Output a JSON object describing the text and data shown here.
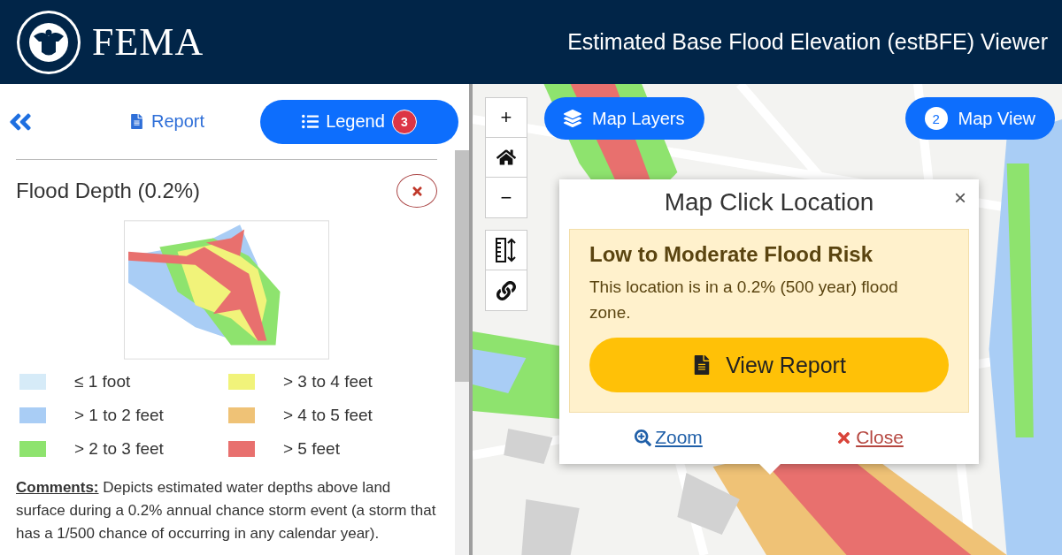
{
  "header": {
    "logo_text": "FEMA",
    "title": "Estimated Base Flood Elevation (estBFE) Viewer"
  },
  "sidebar": {
    "tabs": [
      {
        "label": "Report",
        "kind": "report",
        "selected": false
      },
      {
        "label": "Legend",
        "kind": "legend",
        "selected": true,
        "badge": "3"
      }
    ],
    "legend": {
      "title": "Flood Depth (0.2%)",
      "items": [
        {
          "label": "≤ 1 foot",
          "color": "#d6ebf8"
        },
        {
          "label": "> 3 to 4 feet",
          "color": "#f1f37a"
        },
        {
          "label": "> 1 to 2 feet",
          "color": "#a9cdf5"
        },
        {
          "label": "> 4 to 5 feet",
          "color": "#efc276"
        },
        {
          "label": "> 2 to 3 feet",
          "color": "#8ee36e"
        },
        {
          "label": "> 5 feet",
          "color": "#e8706e"
        }
      ],
      "comments": "**Comments:** Depicts estimated water depths above land surface during a 0.2% annual chance storm event (a storm that has a 1/500 chance of occurring in any calendar year)."
    }
  },
  "map": {
    "controls": [
      {
        "label": "+",
        "kind": "zoom-in"
      },
      {
        "kind": "home"
      },
      {
        "label": "−",
        "kind": "zoom-out"
      }
    ],
    "tools": [
      {
        "kind": "measure"
      },
      {
        "kind": "link"
      }
    ],
    "layers_button": "Map Layers",
    "view_button": {
      "label": "Map View",
      "badge": "2"
    },
    "popup": {
      "title": "Map Click Location",
      "close": "×",
      "risk_title": "Low to Moderate Flood Risk",
      "risk_text": "This location is in a 0.2% (500 year) flood zone.",
      "report_button": "View Report",
      "links": [
        {
          "label": "Zoom",
          "kind": "zoom"
        },
        {
          "label": "Close",
          "kind": "close"
        }
      ]
    }
  }
}
